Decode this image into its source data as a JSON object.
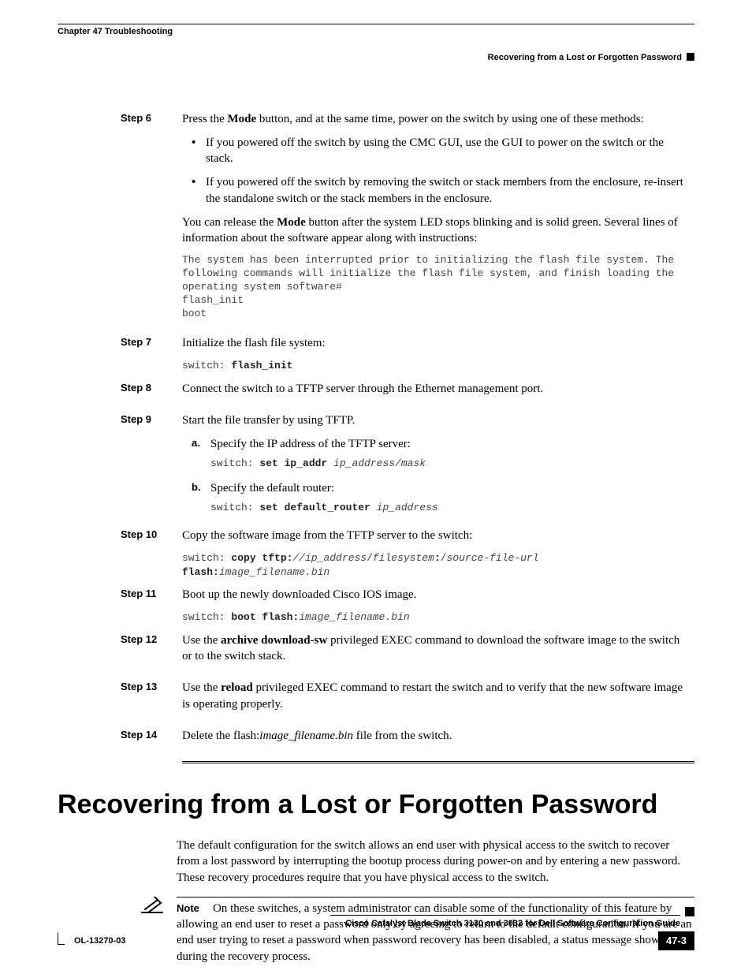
{
  "header": {
    "chapter": "Chapter 47    Troubleshooting",
    "section": "Recovering from a Lost or Forgotten Password"
  },
  "steps": {
    "s6": {
      "label": "Step 6",
      "intro_pre": "Press the ",
      "intro_bold": "Mode",
      "intro_post": " button, and at the same time, power on the switch by using one of these methods:",
      "bullet1": "If you powered off the switch by using the CMC GUI, use the GUI to power on the switch or the stack.",
      "bullet2": "If you powered off the switch by removing the switch or stack members from the enclosure, re-insert the standalone switch or the stack members in the enclosure.",
      "after_pre": "You can release the ",
      "after_bold": "Mode",
      "after_post": " button after the system LED stops blinking and is solid green. Several lines of information about the software appear along with instructions:",
      "codeblock": "The system has been interrupted prior to initializing the flash file system. The following commands will initialize the flash file system, and finish loading the operating system software#\nflash_init\nboot"
    },
    "s7": {
      "label": "Step 7",
      "text": "Initialize the flash file system:",
      "code_prefix": "switch: ",
      "code_bold": "flash_init"
    },
    "s8": {
      "label": "Step 8",
      "text": "Connect the switch to a TFTP server through the Ethernet management port."
    },
    "s9": {
      "label": "Step 9",
      "text": "Start the file transfer by using TFTP.",
      "a": {
        "label": "a.",
        "text": "Specify the IP address of the TFTP server:",
        "code_prefix": "switch: ",
        "code_bold": "set ip_addr",
        "code_italic": " ip_address/mask"
      },
      "b": {
        "label": "b.",
        "text": "Specify the default router:",
        "code_prefix": "switch: ",
        "code_bold": "set default_router",
        "code_italic": " ip_address"
      }
    },
    "s10": {
      "label": "Step 10",
      "text": "Copy the software image from the TFTP server to the switch:",
      "code_prefix": "switch: ",
      "code_b1": "copy tftp:",
      "code_i1": "//ip_address",
      "code_p1": "/",
      "code_i2": "filesystem",
      "code_b2": ":",
      "code_p2": "/",
      "code_i3": "source-file-url",
      "code_b3": " flash:",
      "code_i4": "image_filename.bin"
    },
    "s11": {
      "label": "Step 11",
      "text": "Boot up the newly downloaded Cisco IOS image.",
      "code_prefix": "switch: ",
      "code_bold": "boot flash:",
      "code_italic": "image_filename.bin"
    },
    "s12": {
      "label": "Step 12",
      "pre": "Use the ",
      "bold": "archive download-sw",
      "post": " privileged EXEC command to download the software image to the switch or to the switch stack."
    },
    "s13": {
      "label": "Step 13",
      "pre": "Use the ",
      "bold": "reload",
      "post": " privileged EXEC command to restart the switch and to verify that the new software image is operating properly."
    },
    "s14": {
      "label": "Step 14",
      "pre": "Delete the flash:",
      "italic": "image_filename.bin",
      "post": " file from the switch."
    }
  },
  "section": {
    "title": "Recovering from a Lost or Forgotten Password",
    "para1": "The default configuration for the switch allows an end user with physical access to the switch to recover from a lost password by interrupting the bootup process during power-on and by entering a new password. These recovery procedures require that you have physical access to the switch.",
    "note_label": "Note",
    "note_text": "On these switches, a system administrator can disable some of the functionality of this feature by allowing an end user to reset a password only by agreeing to return to the default configuration. If you are an end user trying to reset a password when password recovery has been disabled, a status message shows this during the recovery process."
  },
  "footer": {
    "title": "Cisco Catalyst Blade Switch 3130 and 3032 for Dell Software Configuration Guide",
    "doc": "OL-13270-03",
    "page": "47-3"
  }
}
